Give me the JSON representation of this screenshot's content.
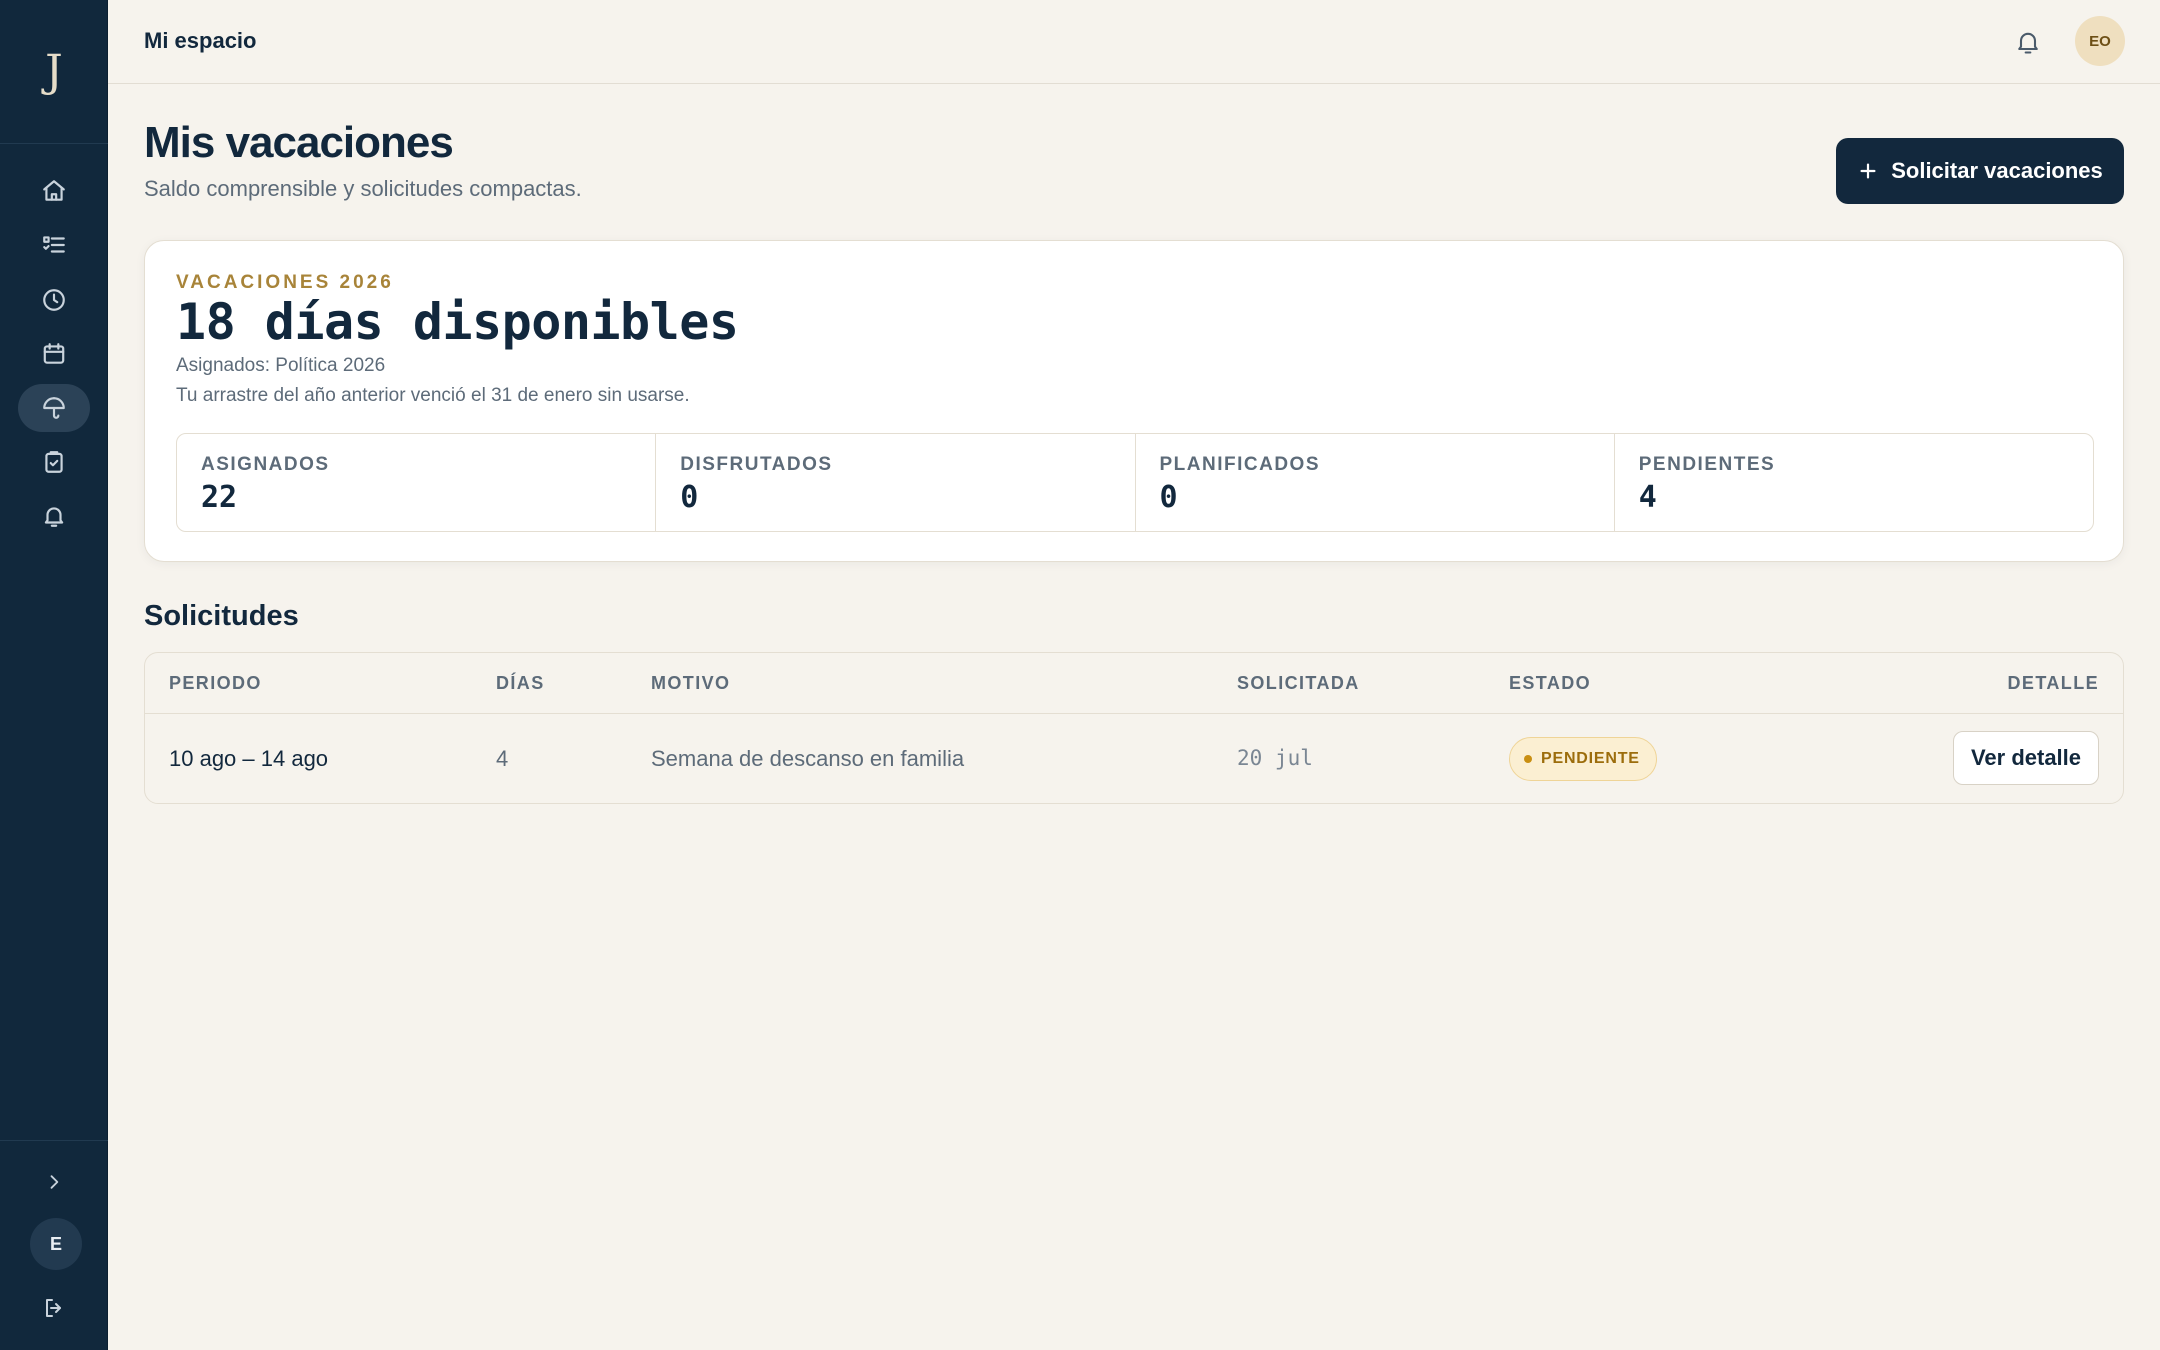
{
  "app": {
    "logo": "J"
  },
  "sidebar": {
    "items": [
      {
        "name": "home",
        "icon": "home-icon"
      },
      {
        "name": "tasks",
        "icon": "checklist-icon"
      },
      {
        "name": "time",
        "icon": "clock-icon"
      },
      {
        "name": "calendar",
        "icon": "calendar-icon"
      },
      {
        "name": "vacations",
        "icon": "umbrella-icon",
        "active": true
      },
      {
        "name": "documents",
        "icon": "clipboard-icon"
      },
      {
        "name": "notifications",
        "icon": "bell-icon"
      }
    ],
    "user_initial": "E"
  },
  "header": {
    "breadcrumb": "Mi espacio",
    "avatar_initials": "EO"
  },
  "page": {
    "title": "Mis vacaciones",
    "subtitle": "Saldo comprensible y solicitudes compactas.",
    "primary_action": "Solicitar vacaciones"
  },
  "balance": {
    "eyebrow": "VACACIONES 2026",
    "headline": "18 días disponibles",
    "assigned_note": "Asignados: Política 2026",
    "carryover_note": "Tu arrastre del año anterior venció el 31 de enero sin usarse.",
    "stats": [
      {
        "label": "ASIGNADOS",
        "value": "22"
      },
      {
        "label": "DISFRUTADOS",
        "value": "0"
      },
      {
        "label": "PLANIFICADOS",
        "value": "0"
      },
      {
        "label": "PENDIENTES",
        "value": "4"
      }
    ]
  },
  "requests": {
    "title": "Solicitudes",
    "columns": [
      "PERIODO",
      "DÍAS",
      "MOTIVO",
      "SOLICITADA",
      "ESTADO",
      "DETALLE"
    ],
    "rows": [
      {
        "period": "10 ago – 14 ago",
        "days": "4",
        "reason": "Semana de descanso en familia",
        "requested": "20 jul",
        "status": "PENDIENTE",
        "action": "Ver detalle"
      }
    ]
  },
  "colors": {
    "sidebar_bg": "#11283c",
    "page_bg": "#f6f3ed",
    "primary": "#12283d",
    "accent_gold": "#a88439",
    "pending_badge_bg": "#fbefd2",
    "pending_badge_text": "#9c6d0c"
  }
}
